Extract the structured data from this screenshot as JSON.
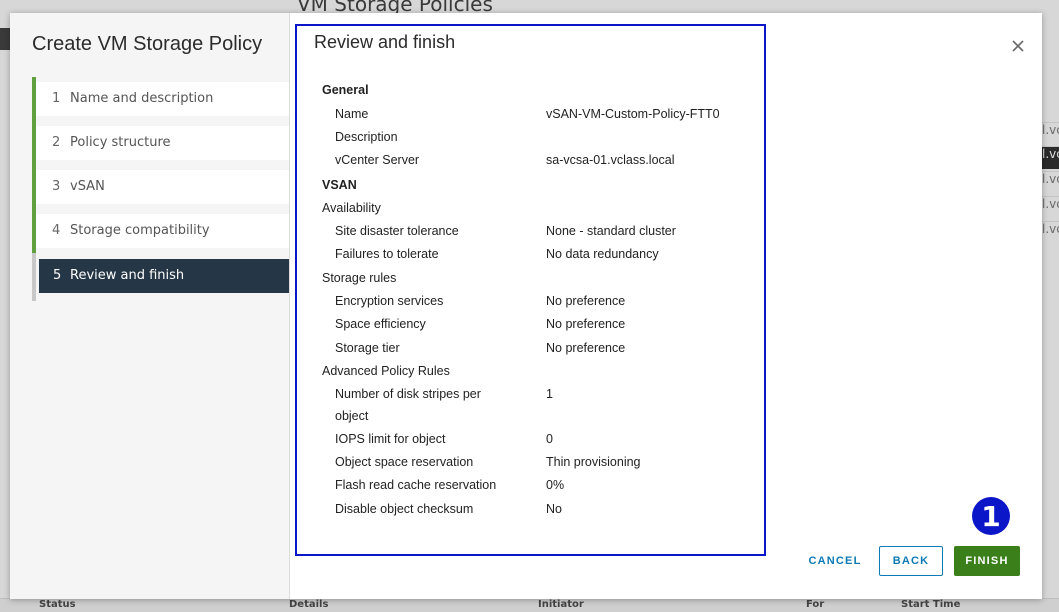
{
  "background": {
    "page_title": "VM Storage Policies",
    "rows": [
      "l.vc",
      "l.vc",
      "l.vc",
      "l.vc",
      "l.vc"
    ],
    "columns": [
      "Status",
      "Details",
      "Initiator",
      "Queued For",
      "Start Time"
    ]
  },
  "modal": {
    "title": "Create VM Storage Policy",
    "steps": [
      {
        "num": "1",
        "label": "Name and description"
      },
      {
        "num": "2",
        "label": "Policy structure"
      },
      {
        "num": "3",
        "label": "vSAN"
      },
      {
        "num": "4",
        "label": "Storage compatibility"
      },
      {
        "num": "5",
        "label": "Review and finish"
      }
    ]
  },
  "review": {
    "title": "Review and finish",
    "general_heading": "General",
    "name_label": "Name",
    "name_value": "vSAN-VM-Custom-Policy-FTT0",
    "description_label": "Description",
    "vcenter_label": "vCenter Server",
    "vcenter_value": "sa-vcsa-01.vclass.local",
    "vsan_heading": "VSAN",
    "availability_heading": "Availability",
    "site_disaster_label": "Site disaster tolerance",
    "site_disaster_value": "None - standard cluster",
    "ftt_label": "Failures to tolerate",
    "ftt_value": "No data redundancy",
    "storage_rules_heading": "Storage rules",
    "encryption_label": "Encryption services",
    "encryption_value": "No preference",
    "space_eff_label": "Space efficiency",
    "space_eff_value": "No preference",
    "storage_tier_label": "Storage tier",
    "storage_tier_value": "No preference",
    "advanced_heading": "Advanced Policy Rules",
    "stripes_label_1": "Number of disk stripes per",
    "stripes_label_2": "object",
    "stripes_value": "1",
    "iops_label": "IOPS limit for object",
    "iops_value": "0",
    "osr_label": "Object space reservation",
    "osr_value": "Thin provisioning",
    "flash_label": "Flash read cache reservation",
    "flash_value": "0%",
    "checksum_label": "Disable object checksum",
    "checksum_value": "No"
  },
  "footer": {
    "cancel": "CANCEL",
    "back": "BACK",
    "finish": "FINISH"
  },
  "annotation_badge": "1",
  "colors": {
    "highlight": "#0a16c8",
    "finish_green": "#3a7f1a",
    "step_active_bg": "#253746",
    "step_complete": "#60a03f"
  }
}
